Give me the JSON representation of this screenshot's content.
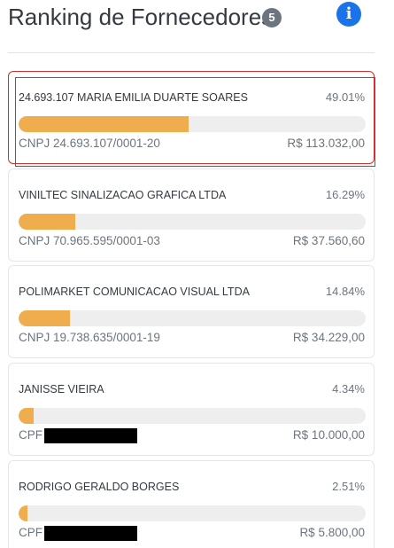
{
  "header": {
    "title": "Ranking de Fornecedores",
    "count": "5",
    "info_icon": "info-icon"
  },
  "colors": {
    "bar_fill": "#f0ad4e",
    "bar_track": "#eeeeee",
    "info_blue": "#1a73e8",
    "badge_gray": "#6c757d",
    "highlight_red": "#d32f2f"
  },
  "suppliers": [
    {
      "name": "24.693.107 MARIA EMILIA DUARTE SOARES",
      "percent": "49.01%",
      "share": 0.4901,
      "doc_label": "CNPJ 24.693.107/0001-20",
      "amount": "R$ 113.032,00",
      "highlighted": true
    },
    {
      "name": "VINILTEC SINALIZACAO GRAFICA LTDA",
      "percent": "16.29%",
      "share": 0.1629,
      "doc_label": "CNPJ 70.965.595/0001-03",
      "amount": "R$ 37.560,60"
    },
    {
      "name": "POLIMARKET COMUNICACAO VISUAL LTDA",
      "percent": "14.84%",
      "share": 0.1484,
      "doc_label": "CNPJ 19.738.635/0001-19",
      "amount": "R$ 34.229,00"
    },
    {
      "name": "JANISSE VIEIRA",
      "percent": "4.34%",
      "share": 0.0434,
      "doc_label": "CPF",
      "redacted": true,
      "amount": "R$ 10.000,00"
    },
    {
      "name": "RODRIGO GERALDO BORGES",
      "percent": "2.51%",
      "share": 0.0251,
      "doc_label": "CPF",
      "redacted": true,
      "amount": "R$ 5.800,00"
    }
  ]
}
